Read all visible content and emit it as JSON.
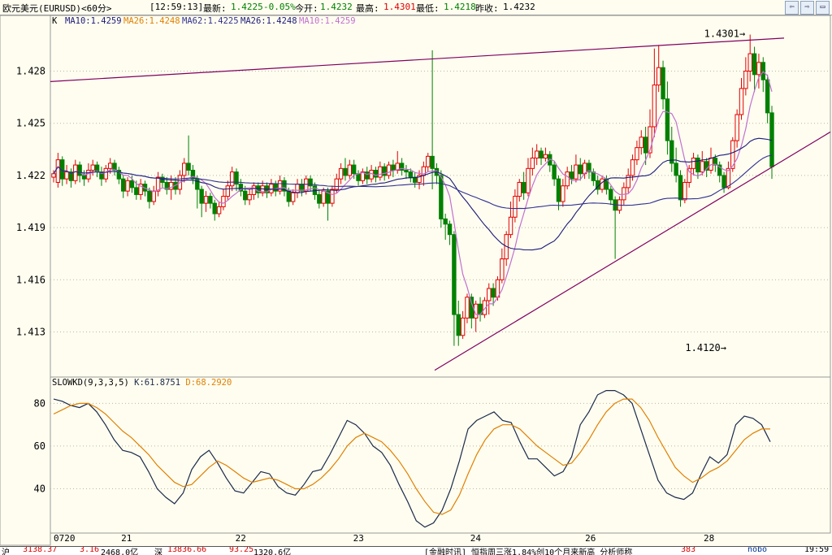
{
  "header": {
    "symbol": "欧元美元(EURUSD)<60分>",
    "time": "[12:59:13]",
    "latest_label": "最新:",
    "latest_value": "1.4225",
    "change": "-0.05%",
    "open_label": "今开:",
    "open_value": "1.4232",
    "high_label": "最高:",
    "high_value": "1.4301",
    "low_label": "最低:",
    "low_value": "1.4218",
    "prev_label": "昨收:",
    "prev_value": "1.4232"
  },
  "legend": {
    "k": "K",
    "ma10": "MA10:1.4259",
    "ma26a": "MA26:1.4248",
    "ma62": "MA62:1.4225",
    "ma26b": "MA26:1.4248",
    "ma10b": "MA10:1.4259"
  },
  "kd_legend": {
    "name": "SLOWKD(9,3,3,5)",
    "k": "K:61.8751",
    "d": "D:68.2920"
  },
  "footer": {
    "a": "沪",
    "a_val": "3138.37",
    "a_chg": "3.16",
    "a_vol": "2468.0亿",
    "b": "深",
    "b_val": "13836.66",
    "b_chg": "93.25",
    "b_vol": "1320.6亿",
    "news": "[金融时讯] 恒指周三涨1.84%创10个月来新高 分析师称",
    "badge": "383",
    "brand": "nobo",
    "clock": "19:59"
  },
  "colors": {
    "up": "#e00000",
    "down": "#008000",
    "ma10": "#c070d0",
    "ma26": "#1a1a7a",
    "ma62": "#303090",
    "channel": "#800060",
    "kline": "#1a2a4a",
    "dline": "#e08000"
  },
  "chart_data": [
    {
      "type": "candlestick",
      "title": "欧元美元(EURUSD)<60分>",
      "yticks": [
        "1.413",
        "1.416",
        "1.419",
        "1.422",
        "1.425",
        "1.428"
      ],
      "ylim": [
        1.4105,
        1.4305
      ],
      "xticks": [
        "0720",
        "21",
        "22",
        "23",
        "24",
        "26",
        "28"
      ],
      "annotations": [
        {
          "text": "1.4301",
          "value": 1.4301
        },
        {
          "text": "1.4120",
          "value": 1.412
        }
      ],
      "candles": [
        [
          1.4219,
          1.4221,
          1.4216,
          1.4223
        ],
        [
          1.4216,
          1.4229,
          1.4213,
          1.4233
        ],
        [
          1.4229,
          1.4218,
          1.4214,
          1.4231
        ],
        [
          1.4218,
          1.4222,
          1.4215,
          1.4226
        ],
        [
          1.4222,
          1.4217,
          1.4213,
          1.4224
        ],
        [
          1.4217,
          1.4226,
          1.4215,
          1.4229
        ],
        [
          1.4226,
          1.422,
          1.4216,
          1.4228
        ],
        [
          1.422,
          1.4218,
          1.4214,
          1.4223
        ],
        [
          1.4218,
          1.4223,
          1.4216,
          1.4227
        ],
        [
          1.4223,
          1.4226,
          1.422,
          1.4229
        ],
        [
          1.4226,
          1.4222,
          1.4219,
          1.4228
        ],
        [
          1.4222,
          1.4218,
          1.4214,
          1.4225
        ],
        [
          1.4218,
          1.4224,
          1.4216,
          1.4226
        ],
        [
          1.4224,
          1.4227,
          1.4221,
          1.423
        ],
        [
          1.4227,
          1.4223,
          1.422,
          1.4229
        ],
        [
          1.4223,
          1.4218,
          1.4215,
          1.4225
        ],
        [
          1.4218,
          1.4211,
          1.4207,
          1.422
        ],
        [
          1.4211,
          1.4217,
          1.4208,
          1.4219
        ],
        [
          1.4217,
          1.4213,
          1.421,
          1.422
        ],
        [
          1.4213,
          1.4209,
          1.4206,
          1.4217
        ],
        [
          1.4209,
          1.4215,
          1.4206,
          1.4218
        ],
        [
          1.4215,
          1.4211,
          1.4208,
          1.4217
        ],
        [
          1.4211,
          1.4205,
          1.4201,
          1.4213
        ],
        [
          1.4205,
          1.4211,
          1.4203,
          1.4214
        ],
        [
          1.4211,
          1.4219,
          1.4208,
          1.4222
        ],
        [
          1.4219,
          1.4216,
          1.4213,
          1.4221
        ],
        [
          1.4216,
          1.4212,
          1.4209,
          1.4219
        ],
        [
          1.4212,
          1.4216,
          1.4206,
          1.422
        ],
        [
          1.4216,
          1.4212,
          1.4209,
          1.4219
        ],
        [
          1.4212,
          1.422,
          1.4209,
          1.4223
        ],
        [
          1.422,
          1.4227,
          1.4216,
          1.423
        ],
        [
          1.4227,
          1.4223,
          1.422,
          1.4243
        ],
        [
          1.4223,
          1.4218,
          1.4215,
          1.4226
        ],
        [
          1.4218,
          1.4212,
          1.4201,
          1.422
        ],
        [
          1.4212,
          1.4204,
          1.4196,
          1.4214
        ],
        [
          1.4204,
          1.4208,
          1.4199,
          1.4211
        ],
        [
          1.4208,
          1.4204,
          1.4201,
          1.421
        ],
        [
          1.4204,
          1.4198,
          1.4194,
          1.4206
        ],
        [
          1.4198,
          1.4202,
          1.4196,
          1.4205
        ],
        [
          1.4202,
          1.4208,
          1.42,
          1.4212
        ],
        [
          1.4208,
          1.4214,
          1.4206,
          1.4217
        ],
        [
          1.4214,
          1.4222,
          1.4211,
          1.4225
        ],
        [
          1.4222,
          1.4215,
          1.4211,
          1.4224
        ],
        [
          1.4215,
          1.4211,
          1.4208,
          1.4218
        ],
        [
          1.4211,
          1.4206,
          1.4203,
          1.4214
        ],
        [
          1.4206,
          1.4209,
          1.4203,
          1.4212
        ],
        [
          1.4209,
          1.4214,
          1.4206,
          1.4216
        ],
        [
          1.4214,
          1.421,
          1.4207,
          1.4216
        ],
        [
          1.421,
          1.4214,
          1.4208,
          1.4217
        ],
        [
          1.4214,
          1.421,
          1.4207,
          1.4216
        ],
        [
          1.421,
          1.4215,
          1.4208,
          1.4218
        ],
        [
          1.4215,
          1.4211,
          1.4208,
          1.4217
        ],
        [
          1.4211,
          1.4217,
          1.4209,
          1.422
        ],
        [
          1.4217,
          1.4211,
          1.4208,
          1.4219
        ],
        [
          1.4211,
          1.4205,
          1.4202,
          1.4213
        ],
        [
          1.4205,
          1.421,
          1.4203,
          1.4212
        ],
        [
          1.421,
          1.4215,
          1.4207,
          1.4218
        ],
        [
          1.4215,
          1.4211,
          1.4208,
          1.4218
        ],
        [
          1.4211,
          1.4218,
          1.4209,
          1.422
        ],
        [
          1.4218,
          1.4214,
          1.4211,
          1.422
        ],
        [
          1.4214,
          1.4209,
          1.4206,
          1.4216
        ],
        [
          1.4209,
          1.4204,
          1.4201,
          1.4212
        ],
        [
          1.4204,
          1.4211,
          1.4202,
          1.4213
        ],
        [
          1.4211,
          1.4204,
          1.4194,
          1.4213
        ],
        [
          1.4204,
          1.4212,
          1.4202,
          1.4214
        ],
        [
          1.4212,
          1.4218,
          1.421,
          1.4221
        ],
        [
          1.4218,
          1.4224,
          1.4215,
          1.4227
        ],
        [
          1.4224,
          1.422,
          1.4217,
          1.423
        ],
        [
          1.422,
          1.4226,
          1.4218,
          1.4229
        ],
        [
          1.4226,
          1.4221,
          1.4218,
          1.4229
        ],
        [
          1.4221,
          1.4217,
          1.4214,
          1.4223
        ],
        [
          1.4217,
          1.4222,
          1.4215,
          1.4224
        ],
        [
          1.4222,
          1.4218,
          1.4215,
          1.4225
        ],
        [
          1.4218,
          1.4223,
          1.4216,
          1.4226
        ],
        [
          1.4223,
          1.4219,
          1.4216,
          1.4225
        ],
        [
          1.4219,
          1.4225,
          1.4217,
          1.4228
        ],
        [
          1.4225,
          1.422,
          1.4217,
          1.4227
        ],
        [
          1.422,
          1.4226,
          1.4218,
          1.4228
        ],
        [
          1.4226,
          1.4223,
          1.4219,
          1.4229
        ],
        [
          1.4223,
          1.4227,
          1.4221,
          1.4234
        ],
        [
          1.4227,
          1.4223,
          1.422,
          1.423
        ],
        [
          1.4223,
          1.4222,
          1.4218,
          1.4226
        ],
        [
          1.4222,
          1.4219,
          1.4216,
          1.4224
        ],
        [
          1.4219,
          1.4216,
          1.4213,
          1.4222
        ],
        [
          1.4216,
          1.422,
          1.4212,
          1.4223
        ],
        [
          1.422,
          1.4225,
          1.4214,
          1.4228
        ],
        [
          1.4225,
          1.4231,
          1.4222,
          1.4233
        ],
        [
          1.4231,
          1.4224,
          1.4212,
          1.4292
        ],
        [
          1.4224,
          1.422,
          1.4215,
          1.4227
        ],
        [
          1.422,
          1.4195,
          1.419,
          1.4223
        ],
        [
          1.4195,
          1.4192,
          1.4183,
          1.4198
        ],
        [
          1.4192,
          1.4186,
          1.418,
          1.4194
        ],
        [
          1.4186,
          1.414,
          1.4122,
          1.4188
        ],
        [
          1.414,
          1.4128,
          1.4122,
          1.4148
        ],
        [
          1.4128,
          1.4138,
          1.4126,
          1.4142
        ],
        [
          1.4138,
          1.415,
          1.4135,
          1.4152
        ],
        [
          1.415,
          1.4138,
          1.4132,
          1.4152
        ],
        [
          1.4138,
          1.4146,
          1.413,
          1.4148
        ],
        [
          1.4146,
          1.414,
          1.4136,
          1.415
        ],
        [
          1.414,
          1.4148,
          1.4138,
          1.415
        ],
        [
          1.4148,
          1.4155,
          1.414,
          1.4158
        ],
        [
          1.4155,
          1.415,
          1.4145,
          1.4158
        ],
        [
          1.415,
          1.416,
          1.4148,
          1.4162
        ],
        [
          1.416,
          1.4172,
          1.4158,
          1.4178
        ],
        [
          1.4172,
          1.4186,
          1.4168,
          1.4188
        ],
        [
          1.4186,
          1.4196,
          1.4184,
          1.4205
        ],
        [
          1.4196,
          1.4208,
          1.4193,
          1.4212
        ],
        [
          1.4208,
          1.4216,
          1.4205,
          1.4218
        ],
        [
          1.4216,
          1.421,
          1.4206,
          1.4222
        ],
        [
          1.421,
          1.4224,
          1.4208,
          1.423
        ],
        [
          1.4224,
          1.423,
          1.422,
          1.4236
        ],
        [
          1.423,
          1.4234,
          1.4226,
          1.4238
        ],
        [
          1.4234,
          1.423,
          1.4226,
          1.4236
        ],
        [
          1.423,
          1.4232,
          1.4228,
          1.4236
        ],
        [
          1.4232,
          1.4226,
          1.4222,
          1.4234
        ],
        [
          1.4226,
          1.4218,
          1.4214,
          1.4228
        ],
        [
          1.4218,
          1.4205,
          1.42,
          1.422
        ],
        [
          1.4205,
          1.4214,
          1.4202,
          1.4218
        ],
        [
          1.4214,
          1.4222,
          1.4212,
          1.4225
        ],
        [
          1.4222,
          1.4218,
          1.4215,
          1.4226
        ],
        [
          1.4218,
          1.4226,
          1.4216,
          1.4232
        ],
        [
          1.4226,
          1.4221,
          1.4217,
          1.423
        ],
        [
          1.4221,
          1.4227,
          1.4218,
          1.4229
        ],
        [
          1.4227,
          1.4222,
          1.4218,
          1.4229
        ],
        [
          1.4222,
          1.4217,
          1.4214,
          1.4224
        ],
        [
          1.4217,
          1.4212,
          1.4209,
          1.422
        ],
        [
          1.4212,
          1.4218,
          1.421,
          1.422
        ],
        [
          1.4218,
          1.4212,
          1.4209,
          1.422
        ],
        [
          1.4212,
          1.4206,
          1.4203,
          1.4214
        ],
        [
          1.4206,
          1.42,
          1.4172,
          1.4208
        ],
        [
          1.42,
          1.4206,
          1.4198,
          1.4208
        ],
        [
          1.4206,
          1.4213,
          1.4203,
          1.4216
        ],
        [
          1.4213,
          1.422,
          1.421,
          1.4224
        ],
        [
          1.422,
          1.4229,
          1.4217,
          1.4232
        ],
        [
          1.4229,
          1.4236,
          1.4226,
          1.424
        ],
        [
          1.4236,
          1.4242,
          1.4232,
          1.4246
        ],
        [
          1.4242,
          1.4233,
          1.4226,
          1.4248
        ],
        [
          1.4233,
          1.4248,
          1.423,
          1.4258
        ],
        [
          1.4248,
          1.4272,
          1.4242,
          1.4293
        ],
        [
          1.4272,
          1.4282,
          1.4268,
          1.4295
        ],
        [
          1.4282,
          1.4264,
          1.4258,
          1.4286
        ],
        [
          1.4264,
          1.424,
          1.4232,
          1.4274
        ],
        [
          1.424,
          1.4227,
          1.4222,
          1.4248
        ],
        [
          1.4227,
          1.422,
          1.4216,
          1.4236
        ],
        [
          1.422,
          1.4206,
          1.4202,
          1.4223
        ],
        [
          1.4206,
          1.4216,
          1.4204,
          1.4218
        ],
        [
          1.4216,
          1.4224,
          1.4213,
          1.4226
        ],
        [
          1.4224,
          1.423,
          1.422,
          1.4233
        ],
        [
          1.423,
          1.4222,
          1.4218,
          1.4232
        ],
        [
          1.4222,
          1.4228,
          1.422,
          1.4234
        ],
        [
          1.4228,
          1.4223,
          1.4219,
          1.423
        ],
        [
          1.4223,
          1.423,
          1.4221,
          1.4236
        ],
        [
          1.423,
          1.4226,
          1.4222,
          1.4232
        ],
        [
          1.4226,
          1.422,
          1.4216,
          1.4228
        ],
        [
          1.422,
          1.4213,
          1.421,
          1.4222
        ],
        [
          1.4213,
          1.4224,
          1.4212,
          1.4228
        ],
        [
          1.4224,
          1.424,
          1.4222,
          1.4242
        ],
        [
          1.424,
          1.4255,
          1.4236,
          1.4258
        ],
        [
          1.4255,
          1.427,
          1.4252,
          1.4276
        ],
        [
          1.427,
          1.428,
          1.4266,
          1.4288
        ],
        [
          1.428,
          1.429,
          1.4274,
          1.4301
        ],
        [
          1.429,
          1.4278,
          1.4268,
          1.4294
        ],
        [
          1.4278,
          1.4285,
          1.427,
          1.429
        ],
        [
          1.4285,
          1.4275,
          1.4268,
          1.4288
        ],
        [
          1.4275,
          1.4256,
          1.425,
          1.4278
        ],
        [
          1.4256,
          1.4225,
          1.4218,
          1.426
        ]
      ]
    },
    {
      "type": "line",
      "title": "SLOWKD(9,3,3,5)",
      "yticks": [
        "40",
        "60",
        "80"
      ],
      "ylim": [
        20,
        87
      ],
      "series": [
        {
          "name": "K",
          "values": [
            82,
            81,
            79,
            78,
            80,
            76,
            70,
            63,
            58,
            57,
            55,
            48,
            40,
            36,
            33,
            38,
            49,
            55,
            58,
            52,
            45,
            39,
            38,
            43,
            48,
            47,
            41,
            38,
            37,
            42,
            48,
            49,
            56,
            64,
            72,
            70,
            66,
            60,
            57,
            51,
            42,
            34,
            25,
            22,
            24,
            30,
            40,
            53,
            68,
            72,
            74,
            76,
            72,
            71,
            62,
            54,
            54,
            50,
            46,
            48,
            55,
            70,
            76,
            84,
            86,
            86,
            84,
            80,
            68,
            56,
            44,
            38,
            36,
            35,
            38,
            47,
            55,
            52,
            56,
            70,
            74,
            73,
            70,
            62
          ]
        },
        {
          "name": "D",
          "values": [
            75,
            77,
            79,
            80,
            80,
            78,
            75,
            71,
            67,
            64,
            60,
            56,
            51,
            47,
            43,
            41,
            42,
            46,
            50,
            53,
            51,
            48,
            45,
            43,
            44,
            45,
            44,
            42,
            40,
            40,
            42,
            45,
            49,
            54,
            60,
            64,
            66,
            64,
            62,
            58,
            53,
            47,
            40,
            34,
            29,
            28,
            30,
            37,
            47,
            56,
            63,
            68,
            70,
            70,
            68,
            64,
            60,
            57,
            54,
            51,
            52,
            57,
            63,
            70,
            76,
            80,
            82,
            82,
            78,
            72,
            64,
            57,
            50,
            46,
            43,
            45,
            48,
            50,
            53,
            58,
            63,
            66,
            68,
            68
          ]
        }
      ]
    }
  ]
}
